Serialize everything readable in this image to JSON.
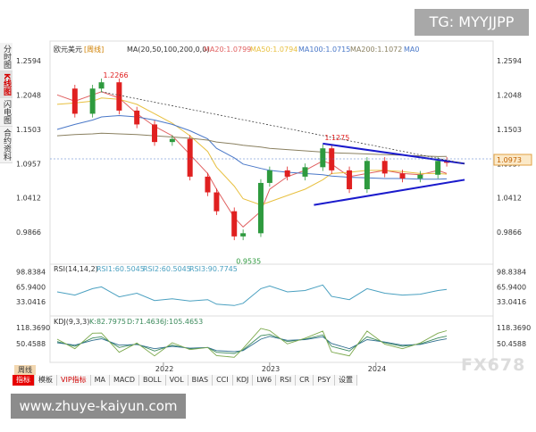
{
  "watermark": "TG: MYYJJPP",
  "fx_mark": "FX678",
  "bottom_url": "www.zhuye-kaiyun.com",
  "left_tabs": [
    "分时图",
    "K线图",
    "闪电图",
    "合约资料"
  ],
  "weekly_label": "周线",
  "toolbar": [
    "指标",
    "模板",
    "VIP指标",
    "MA",
    "MACD",
    "BOLL",
    "VOL",
    "BIAS",
    "CCI",
    "KDJ",
    "LW6",
    "RSI",
    "CR",
    "PSY",
    "设置"
  ],
  "header": {
    "instrument": "欧元美元",
    "period": "[周线]",
    "ma_params": "MA(20,50,100,200,0,0)",
    "ma20": "MA20:1.0799",
    "ma50": "MA50:1.0794",
    "ma100": "MA100:1.0715",
    "ma200": "MA200:1.1072",
    "ma0": "MA0"
  },
  "rsi_header": {
    "title": "RSI(14,14,2)",
    "rsi1": "RSI1:60.5045",
    "rsi2": "RSI2:60.5045",
    "rsi3": "RSI3:90.7745"
  },
  "kdj_header": {
    "title": "KDJ(9,3,3)",
    "k": "K:82.7975",
    "d": "D:71.4636",
    "j": "J:105.4653"
  },
  "colors": {
    "up": "#2e9a3e",
    "down": "#e02020",
    "ma20": "#e06060",
    "ma50": "#e8c040",
    "ma100": "#4a78c8",
    "ma200": "#8a8060",
    "trend": "#1a1acc"
  },
  "chart_data": {
    "type": "candlestick",
    "price_axis_ticks": [
      "1.2594",
      "1.2048",
      "1.1503",
      "1.0957",
      "1.0412",
      "0.9866"
    ],
    "price_ylim": [
      0.95,
      1.265
    ],
    "current_price": "1.0973",
    "annotations": [
      {
        "label": "1.2266",
        "x": "2021-06",
        "y": 1.2266
      },
      {
        "label": "0.9535",
        "x": "2022-09",
        "y": 0.9535
      },
      {
        "label": "1.1275",
        "x": "2023-07",
        "y": 1.1275
      }
    ],
    "x_ticks": [
      "2022",
      "2023",
      "2024"
    ],
    "price_series": {
      "x": [
        "2021-01",
        "2021-03",
        "2021-05",
        "2021-06",
        "2021-08",
        "2021-10",
        "2021-12",
        "2022-02",
        "2022-04",
        "2022-06",
        "2022-07",
        "2022-09",
        "2022-10",
        "2022-12",
        "2023-01",
        "2023-03",
        "2023-05",
        "2023-07",
        "2023-08",
        "2023-10",
        "2023-12",
        "2024-02",
        "2024-04",
        "2024-06",
        "2024-08",
        "2024-09"
      ],
      "close": [
        1.215,
        1.175,
        1.215,
        1.225,
        1.18,
        1.158,
        1.13,
        1.135,
        1.075,
        1.05,
        1.02,
        0.98,
        0.985,
        1.065,
        1.085,
        1.075,
        1.09,
        1.12,
        1.085,
        1.055,
        1.1,
        1.08,
        1.072,
        1.078,
        1.1,
        1.097
      ]
    },
    "ma_series": [
      {
        "name": "MA20",
        "values": [
          1.205,
          1.195,
          1.205,
          1.21,
          1.2,
          1.175,
          1.155,
          1.14,
          1.11,
          1.08,
          1.055,
          1.01,
          0.995,
          1.02,
          1.055,
          1.075,
          1.085,
          1.1,
          1.095,
          1.075,
          1.08,
          1.085,
          1.08,
          1.078,
          1.085,
          1.08
        ]
      },
      {
        "name": "MA50",
        "values": [
          1.19,
          1.192,
          1.195,
          1.2,
          1.198,
          1.19,
          1.175,
          1.16,
          1.14,
          1.115,
          1.09,
          1.06,
          1.04,
          1.03,
          1.035,
          1.045,
          1.055,
          1.07,
          1.08,
          1.082,
          1.085,
          1.085,
          1.083,
          1.08,
          1.08,
          1.079
        ]
      },
      {
        "name": "MA100",
        "values": [
          1.15,
          1.158,
          1.165,
          1.17,
          1.172,
          1.17,
          1.165,
          1.158,
          1.148,
          1.135,
          1.12,
          1.105,
          1.095,
          1.088,
          1.085,
          1.082,
          1.08,
          1.078,
          1.076,
          1.074,
          1.073,
          1.072,
          1.072,
          1.071,
          1.071,
          1.0715
        ]
      },
      {
        "name": "MA200",
        "values": [
          1.14,
          1.142,
          1.143,
          1.144,
          1.143,
          1.142,
          1.14,
          1.138,
          1.136,
          1.133,
          1.13,
          1.127,
          1.125,
          1.122,
          1.12,
          1.118,
          1.116,
          1.114,
          1.113,
          1.112,
          1.111,
          1.11,
          1.109,
          1.108,
          1.107,
          1.1072
        ]
      }
    ],
    "trendlines": [
      {
        "name": "upper",
        "from": [
          "2023-07",
          1.1275
        ],
        "to": [
          "2024-09",
          1.0957
        ]
      },
      {
        "name": "lower",
        "from": [
          "2023-06",
          1.03
        ],
        "to": [
          "2024-09",
          1.07
        ]
      },
      {
        "name": "dotted",
        "from": [
          "2021-06",
          1.21
        ],
        "to": [
          "2024-09",
          1.0957
        ]
      }
    ],
    "rsi_axis_ticks": [
      "98.8384",
      "65.9400",
      "33.0416"
    ],
    "rsi_ylim": [
      10,
      100
    ],
    "rsi_series": {
      "name": "RSI",
      "values": [
        55,
        48,
        62,
        66,
        44,
        52,
        36,
        40,
        35,
        38,
        28,
        25,
        30,
        62,
        68,
        55,
        58,
        70,
        45,
        38,
        62,
        52,
        48,
        50,
        58,
        60.5
      ]
    },
    "kdj_axis_ticks": [
      "118.3690",
      "50.4588"
    ],
    "kdj_ylim": [
      -20,
      130
    ],
    "kdj_series": [
      {
        "name": "K",
        "values": [
          60,
          40,
          75,
          80,
          35,
          50,
          20,
          45,
          30,
          35,
          15,
          10,
          25,
          85,
          90,
          60,
          70,
          88,
          40,
          20,
          80,
          55,
          40,
          50,
          75,
          82.8
        ]
      },
      {
        "name": "D",
        "values": [
          55,
          45,
          65,
          72,
          45,
          48,
          30,
          40,
          32,
          35,
          22,
          18,
          22,
          70,
          82,
          65,
          68,
          80,
          52,
          30,
          68,
          58,
          45,
          48,
          65,
          71.5
        ]
      },
      {
        "name": "J",
        "values": [
          70,
          30,
          95,
          96,
          15,
          54,
          0,
          55,
          26,
          35,
          1,
          -6,
          31,
          115,
          106,
          50,
          74,
          104,
          16,
          0,
          104,
          49,
          30,
          54,
          95,
          105.5
        ]
      }
    ]
  }
}
